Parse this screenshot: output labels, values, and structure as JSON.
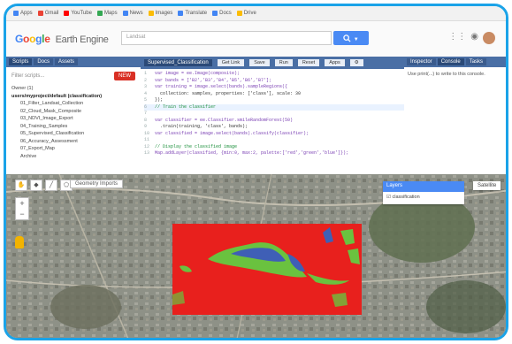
{
  "colors": {
    "accent": "#1aa3e8",
    "panel_header": "#4a6fa5",
    "search_button": "#4a8af4",
    "new_button": "#d93025",
    "class_red": "#e8201d",
    "class_green": "#6ac23f",
    "class_blue": "#3f5fb6"
  },
  "bookmarks": [
    "Apps",
    "Gmail",
    "YouTube",
    "Maps",
    "News",
    "Images",
    "Translate",
    "Docs",
    "Drive"
  ],
  "header": {
    "logo_google": "Google",
    "logo_product": "Earth Engine",
    "search_value": "Landsat",
    "search_button_icon": "search-icon"
  },
  "left_panel": {
    "tabs": [
      "Scripts",
      "Docs",
      "Assets"
    ],
    "filter_placeholder": "Filter scripts...",
    "new_label": "NEW",
    "tree_root": "Owner (1)",
    "repo_name": "users/myproject/default (classification)",
    "files": [
      "01_Filter_Landsat_Collection",
      "02_Cloud_Mask_Composite",
      "03_NDVI_Image_Export",
      "04_Training_Samples",
      "05_Supervised_Classification",
      "06_Accuracy_Assessment",
      "07_Export_Map",
      "Archive"
    ]
  },
  "editor": {
    "file_name": "Supervised_Classification",
    "buttons": [
      "Get Link",
      "Save",
      "Run",
      "Reset",
      "Apps",
      "⚙"
    ],
    "code_lines": [
      {
        "n": "1",
        "text": "var image = ee.Image(composite);"
      },
      {
        "n": "2",
        "text": "var bands = ['B2','B3','B4','B5','B6','B7'];"
      },
      {
        "n": "3",
        "text": "var training = image.select(bands).sampleRegions({"
      },
      {
        "n": "4",
        "text": "  collection: samples, properties: ['class'], scale: 30"
      },
      {
        "n": "5",
        "text": "});"
      },
      {
        "n": "6",
        "text": "// Train the classifier",
        "hl": true
      },
      {
        "n": "7",
        "text": ""
      },
      {
        "n": "8",
        "text": "var classifier = ee.Classifier.smileRandomForest(50)"
      },
      {
        "n": "9",
        "text": "  .train(training, 'class', bands);"
      },
      {
        "n": "10",
        "text": "var classified = image.select(bands).classify(classifier);"
      },
      {
        "n": "11",
        "text": ""
      },
      {
        "n": "12",
        "text": "// Display the classified image"
      },
      {
        "n": "13",
        "text": "Map.addLayer(classified, {min:0, max:2, palette:['red','green','blue']});"
      }
    ]
  },
  "right_panel": {
    "tabs": [
      "Inspector",
      "Console",
      "Tasks"
    ],
    "output": "Use print(...) to write to this console."
  },
  "map": {
    "geometry_label": "Geometry Imports",
    "layers_title": "Layers",
    "layer_name": "classification",
    "map_type": "Satellite"
  }
}
